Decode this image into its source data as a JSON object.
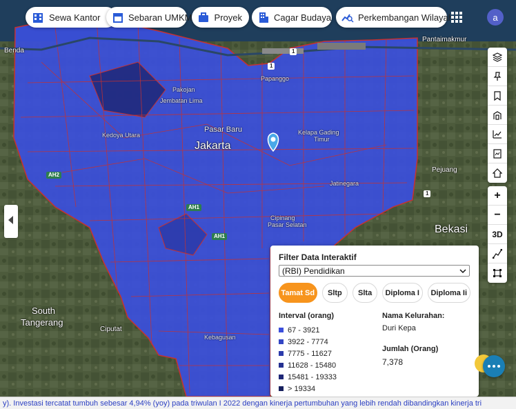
{
  "top_nav": {
    "items": [
      {
        "label": "Sewa Kantor",
        "icon": "office-building-icon"
      },
      {
        "label": "Sebaran UMKM",
        "icon": "storefront-icon"
      },
      {
        "label": "Proyek",
        "icon": "briefcase-icon"
      },
      {
        "label": "Cagar Budaya",
        "icon": "heritage-building-icon"
      },
      {
        "label": "Perkembangan Wilayah",
        "icon": "chart-search-icon"
      }
    ],
    "apps_icon": "apps-grid-icon",
    "avatar_initial": "a"
  },
  "map": {
    "labels": {
      "jakarta": "Jakarta",
      "bekasi": "Bekasi",
      "south_tangerang_1": "South",
      "south_tangerang_2": "Tangerang",
      "benda": "Benda",
      "ciputat": "Ciputat",
      "pejuang": "Pejuang",
      "pantai_makmur": "Pantaimakmur",
      "papanggo": "Papanggo",
      "pasar_baru": "Pasar Baru",
      "kelapa_gading": "Kelapa Gading",
      "timur": "Timur",
      "kedoya": "Kedoya Utara",
      "jembatan_lima": "Jembatan Lima",
      "pakojan": "Pakojan",
      "jatinegara": "Jatinegara",
      "cipinang": "Cipinang",
      "pasar_selatan": "Pasar Selatan",
      "kebagusan": "Kebagusan"
    },
    "road_badges": [
      "AH2",
      "AH2",
      "1",
      "1",
      "1",
      "AH1",
      "AH1"
    ],
    "colors": {
      "choropleth_fill": "#3b4fdc",
      "boundary": "#c8312f",
      "satellite_base": "#4a5a3a"
    },
    "marker": "map-pin-icon"
  },
  "toolbar": {
    "icons": [
      "layers-icon",
      "pin-icon",
      "bookmark-icon",
      "building-icon",
      "line-chart-icon",
      "image-download-icon",
      "home-icon"
    ],
    "zoom_in": "+",
    "zoom_out": "−",
    "view_3d": "3D",
    "extra_icons": [
      "measure-path-icon",
      "polygon-select-icon"
    ]
  },
  "filter_panel": {
    "title": "Filter Data Interaktif",
    "dataset_selected": "(RBI) Pendidikan",
    "chips": [
      {
        "label": "Tamat Sd",
        "active": true
      },
      {
        "label": "Sltp",
        "active": false
      },
      {
        "label": "Slta",
        "active": false
      },
      {
        "label": "Diploma I",
        "active": false
      },
      {
        "label": "Diploma Ii",
        "active": false
      }
    ],
    "interval_heading": "Interval (orang)",
    "legend": [
      {
        "label": "67 - 3921",
        "color": "#3b4fdc"
      },
      {
        "label": "3922 - 7774",
        "color": "#3346c4"
      },
      {
        "label": "7775 - 11627",
        "color": "#2c3bab"
      },
      {
        "label": "11628 - 15480",
        "color": "#253191"
      },
      {
        "label": "15481 - 19333",
        "color": "#1e2777"
      },
      {
        "label": "> 19334",
        "color": "#17205e"
      }
    ],
    "kelurahan_heading": "Nama Kelurahan:",
    "kelurahan_value": "Duri Kepa",
    "jumlah_heading": "Jumlah (Orang)",
    "jumlah_value": "7,378"
  },
  "chat_icon": "chat-bubble-icon",
  "ticker": {
    "text": "y). Investasi tercatat tumbuh sebesar 4,94% (yoy) pada triwulan I 2022 dengan kinerja pertumbuhan yang lebih rendah dibandingkan kinerja tri"
  }
}
